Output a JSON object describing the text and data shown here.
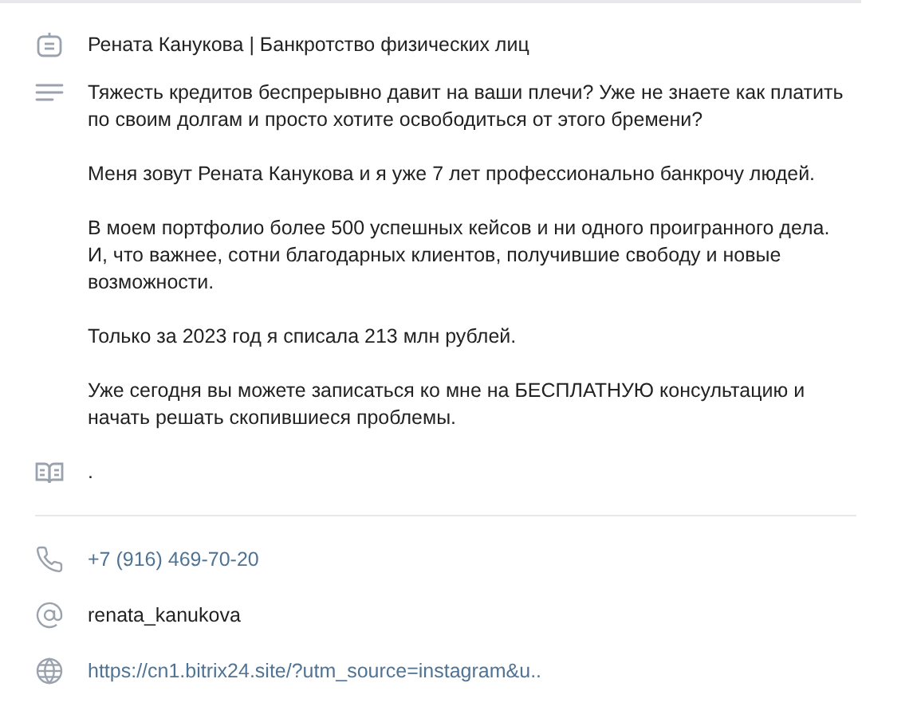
{
  "title": "Рената Канукова | Банкротство физических лиц",
  "description": [
    "Тяжесть кредитов беспрерывно давит на ваши плечи? Уже не знаете как платить по своим долгам и просто хотите освободиться от этого бремени?",
    "Меня зовут Рената Канукова и я уже 7 лет профессионально банкрочу людей.",
    "В моем портфолио более 500 успешных кейсов и ни одного проигранного дела. И, что важнее, сотни благодарных клиентов, получившие свободу и новые возможности.",
    "Только за 2023 год я списала 213 млн рублей.",
    "Уже сегодня вы можете записаться ко мне на БЕСПЛАТНУЮ консультацию и начать решать скопившиеся проблемы."
  ],
  "notes": ".",
  "contacts": [
    {
      "kind": "phone",
      "text": "+7 (916) 469-70-20"
    },
    {
      "kind": "username",
      "text": "renata_kanukova"
    },
    {
      "kind": "link",
      "text": "https://cn1.bitrix24.site/?utm_source=instagram&u.."
    }
  ]
}
